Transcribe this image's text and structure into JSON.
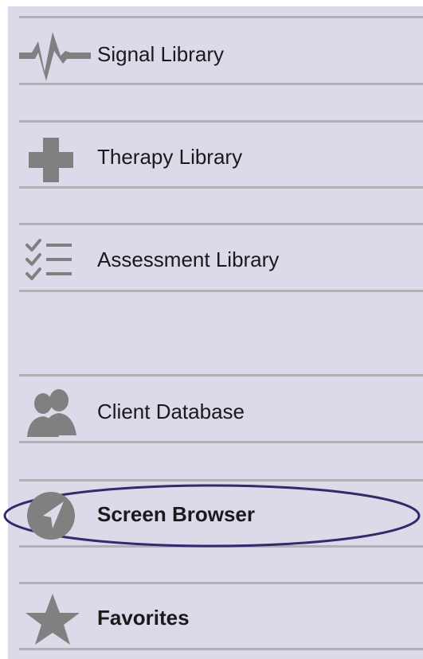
{
  "nav": {
    "items": [
      {
        "label": "Signal Library",
        "icon": "pulse-icon"
      },
      {
        "label": "Therapy Library",
        "icon": "cross-icon"
      },
      {
        "label": "Assessment Library",
        "icon": "checklist-icon"
      },
      {
        "label": "Client Database",
        "icon": "users-icon"
      },
      {
        "label": "Screen Browser",
        "icon": "compass-arrow-icon",
        "highlighted": true
      },
      {
        "label": "Favorites",
        "icon": "star-icon"
      }
    ]
  },
  "colors": {
    "panel_background": "#dcd9e8",
    "divider": "#aeb0b3",
    "icon": "#808080",
    "highlight_outline": "#33296b",
    "text": "#1a1a1a"
  }
}
